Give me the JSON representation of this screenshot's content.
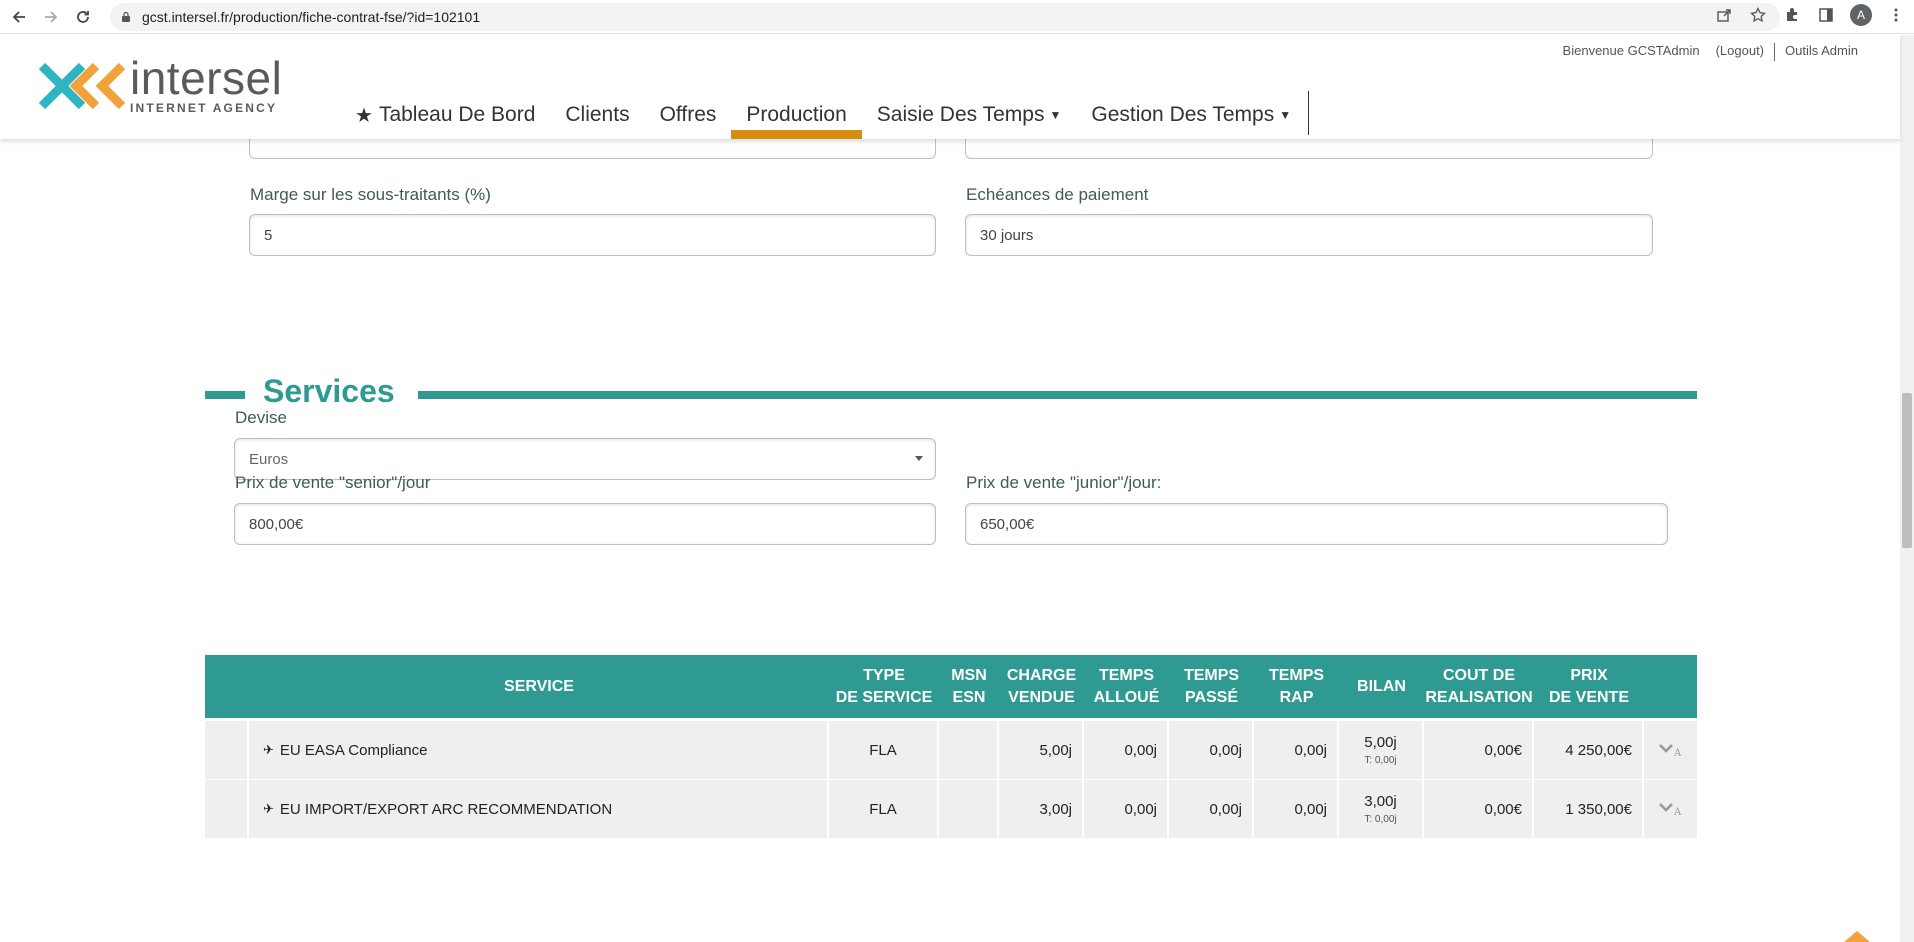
{
  "browser": {
    "url": "gcst.intersel.fr/production/fiche-contrat-fse/?id=102101",
    "profile_initial": "A"
  },
  "header": {
    "logo_name": "intersel",
    "logo_sub": "INTERNET AGENCY",
    "welcome": "Bienvenue GCSTAdmin",
    "logout": "(Logout)",
    "admin_tools": "Outils Admin",
    "nav": {
      "dashboard": "Tableau De Bord",
      "clients": "Clients",
      "offres": "Offres",
      "production": "Production",
      "saisie": "Saisie Des Temps",
      "gestion": "Gestion Des Temps"
    }
  },
  "form_top": {
    "margin_label": "Marge sur les sous-traitants (%)",
    "margin_value": "5",
    "payment_label": "Echéances de paiement",
    "payment_value": "30 jours"
  },
  "services": {
    "title": "Services",
    "devise_label": "Devise",
    "devise_value": "Euros",
    "senior_label": "Prix de vente \"senior\"/jour",
    "senior_value": "800,00€",
    "junior_label": "Prix de vente \"junior\"/jour:",
    "junior_value": "650,00€"
  },
  "table": {
    "headers": {
      "service": "SERVICE",
      "type_1": "TYPE",
      "type_2": "DE SERVICE",
      "msn_1": "MSN",
      "msn_2": "ESN",
      "charge_1": "CHARGE",
      "charge_2": "VENDUE",
      "alloue_1": "TEMPS",
      "alloue_2": "ALLOUÉ",
      "passe_1": "TEMPS",
      "passe_2": "PASSÉ",
      "rap_1": "TEMPS",
      "rap_2": "RAP",
      "bilan": "BILAN",
      "cout_1": "COUT DE",
      "cout_2": "REALISATION",
      "prix_1": "PRIX",
      "prix_2": "DE VENTE"
    },
    "rows": [
      {
        "service": "EU EASA Compliance",
        "type": "FLA",
        "msn": "",
        "charge": "5,00j",
        "alloue": "0,00j",
        "passe": "0,00j",
        "rap": "0,00j",
        "bilan": "5,00j",
        "bilan_sub": "T: 0,00j",
        "cout": "0,00€",
        "prix": "4 250,00€"
      },
      {
        "service": "EU IMPORT/EXPORT ARC RECOMMENDATION",
        "type": "FLA",
        "msn": "",
        "charge": "3,00j",
        "alloue": "0,00j",
        "passe": "0,00j",
        "rap": "0,00j",
        "bilan": "3,00j",
        "bilan_sub": "T: 0,00j",
        "cout": "0,00€",
        "prix": "1 350,00€"
      }
    ]
  },
  "colors": {
    "teal": "#2e9a91",
    "nav_active": "#d48d0f",
    "row_bg": "#efefef"
  }
}
